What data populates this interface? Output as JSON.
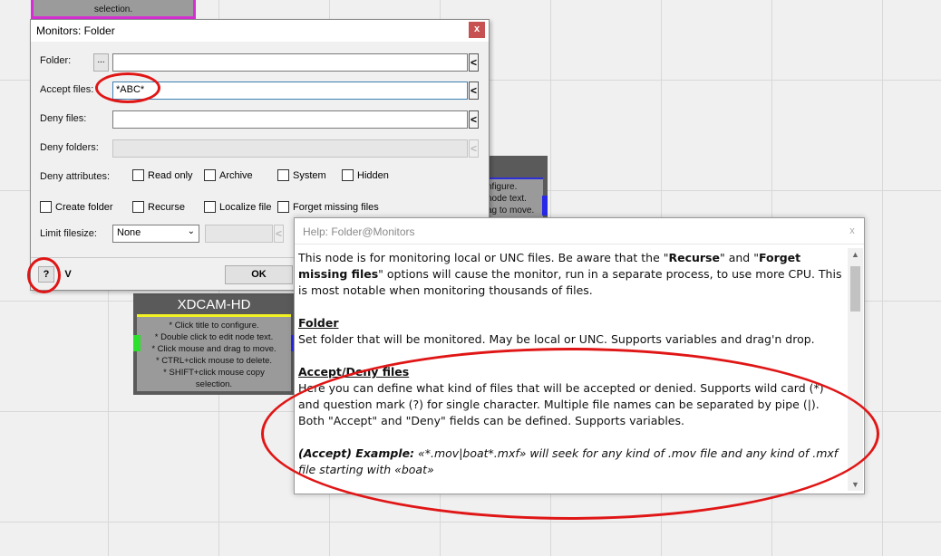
{
  "canvas": {
    "top_node": {
      "text": "selection."
    },
    "partial_node": {
      "lines": [
        "nfigure.",
        "node text.",
        "ag to move."
      ]
    },
    "xdcam_node": {
      "title": "XDCAM-HD",
      "lines": [
        "* Click title to configure.",
        "* Double click to edit node text.",
        "* Click mouse and drag to move.",
        "* CTRL+click mouse to delete.",
        "* SHIFT+click mouse copy",
        "selection."
      ]
    }
  },
  "dialog": {
    "title": "Monitors: Folder",
    "close": "x",
    "folder": {
      "label": "Folder:",
      "browse": "...",
      "value": ""
    },
    "accept": {
      "label": "Accept files:",
      "value": "*ABC*"
    },
    "deny_files": {
      "label": "Deny files:",
      "value": ""
    },
    "deny_folders": {
      "label": "Deny folders:",
      "value": ""
    },
    "arrow": "<",
    "deny_attributes": {
      "label": "Deny attributes:",
      "options": [
        "Read only",
        "Archive",
        "System",
        "Hidden"
      ]
    },
    "options": [
      "Create folder",
      "Recurse",
      "Localize file",
      "Forget missing files"
    ],
    "limit": {
      "label": "Limit filesize:",
      "value": "None"
    },
    "help_button": "?",
    "v_button": "V",
    "ok_button": "OK"
  },
  "help": {
    "title": "Help: Folder@Monitors",
    "close": "x",
    "intro_a": "This node is for monitoring local or UNC files. Be aware that the \"",
    "intro_b": "Recurse",
    "intro_c": "\" and \"",
    "intro_d": "Forget missing files",
    "intro_e": "\" options will cause the monitor, run in a separate process, to use more CPU. This is most notable when monitoring thousands of files.",
    "folder_heading": "Folder",
    "folder_text": "Set folder that will be monitored. May be local or UNC. Supports variables and drag'n drop.",
    "accept_heading": "Accept/Deny files",
    "accept_text": "Here you can define what kind of files that will be accepted or denied. Supports wild card (*) and question mark (?) for single character. Multiple file names can be separated by pipe (|). Both \"Accept\" and \"Deny\" fields can be defined. Supports variables.",
    "example_label": "(Accept) Example:",
    "example_text": " «*.mov|boat*.mxf» will seek for any kind of .mov file and any kind of .mxf file starting with «boat»"
  },
  "colors": {
    "annotation": "#e01616",
    "pink_node_border": "#d62fd3",
    "close_button": "#c75050"
  }
}
